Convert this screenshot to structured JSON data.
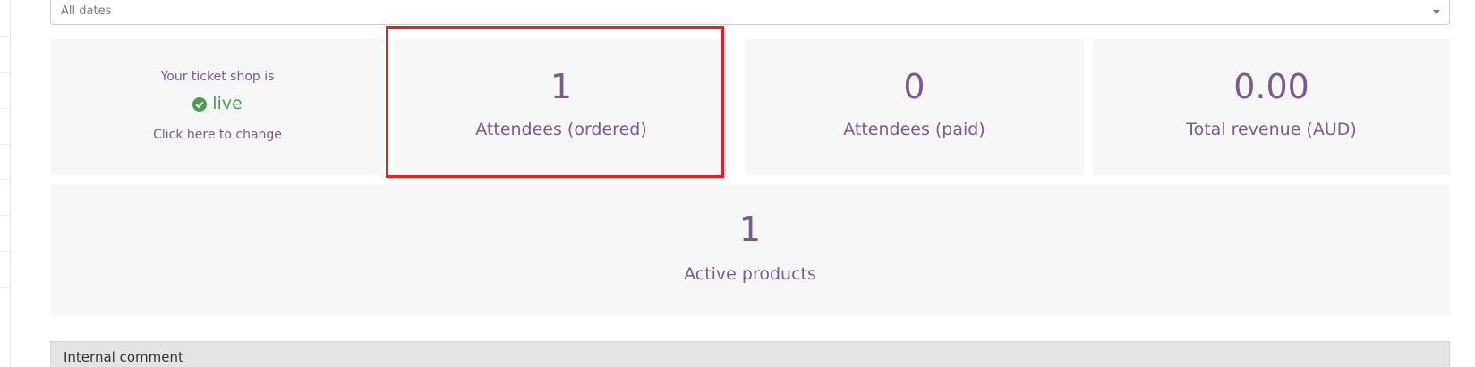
{
  "filter": {
    "date_select_value": "All dates",
    "caret_icon": "chevron-down-icon"
  },
  "shop_status": {
    "intro": "Your ticket shop is",
    "status_icon": "check-circle-icon",
    "status": "live",
    "action": "Click here to change",
    "status_color": "#4b9a55"
  },
  "stats": [
    {
      "value": "1",
      "label": "Attendees (ordered)"
    },
    {
      "value": "0",
      "label": "Attendees (paid)"
    },
    {
      "value": "0.00",
      "label": "Total revenue (AUD)"
    }
  ],
  "products": {
    "value": "1",
    "label": "Active products"
  },
  "internal_comment": {
    "title": "Internal comment"
  },
  "colors": {
    "accent": "#7b5b8f",
    "card_background": "#f7f7f7",
    "highlight": "#ee1b24",
    "comment_background": "#e4e4e4"
  }
}
